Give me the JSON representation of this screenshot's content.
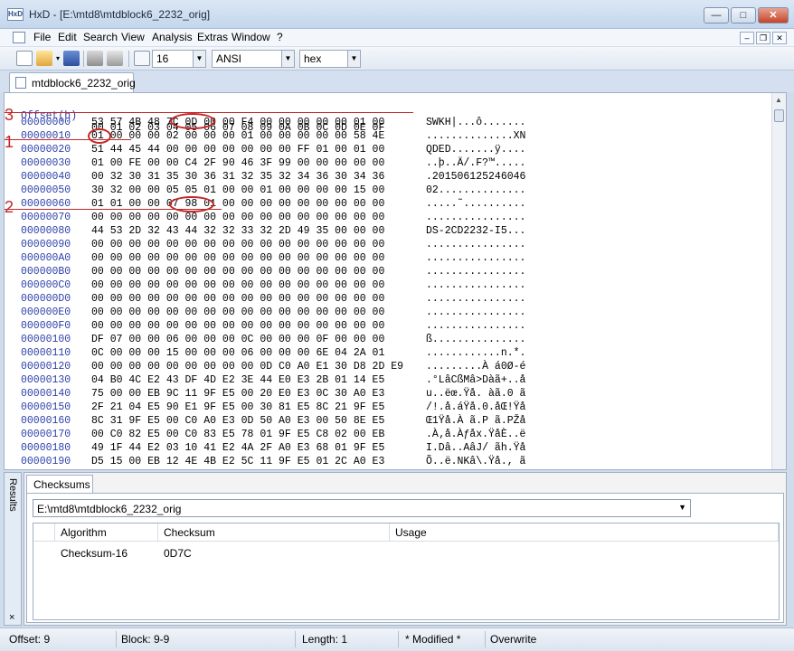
{
  "window": {
    "title": "HxD - [E:\\mtd8\\mtdblock6_2232_orig]",
    "app_icon_label": "HxD",
    "controls": {
      "minimize": "—",
      "maximize": "□",
      "close": "✕"
    }
  },
  "menu": {
    "items": [
      "File",
      "Edit",
      "Search",
      "View",
      "Analysis",
      "Extras",
      "Window",
      "?"
    ],
    "mdi_controls": [
      "–",
      "❐",
      "✕"
    ]
  },
  "toolbar": {
    "bytes_per_row": "16",
    "charset": "ANSI",
    "display": "hex",
    "icons": [
      "new-file-icon",
      "open-file-icon",
      "save-icon",
      "print-icon",
      "print-setup-icon",
      "columns-icon"
    ]
  },
  "document_tab": {
    "label": "mtdblock6_2232_orig"
  },
  "hex": {
    "header_label": "Offset(h)",
    "header_columns": "00 01 02 03 04 05 06 07 08 09 0A 0B 0C 0D 0E 0F",
    "rows": [
      {
        "offset": "00000000",
        "bytes": "53 57 4B 48 7C 0D 00 00 F4 00 00 00 00 00 01 00",
        "text": "SWKH|...ô......."
      },
      {
        "offset": "00000010",
        "bytes": "01 00 00 00 02 00 00 00 01 00 00 00 00 00 58 4E",
        "text": "..............XN"
      },
      {
        "offset": "00000020",
        "bytes": "51 44 45 44 00 00 00 00 00 00 00 FF 01 00 01 00",
        "text": "QDED.......ÿ...."
      },
      {
        "offset": "00000030",
        "bytes": "01 00 FE 00 00 C4 2F 90 46 3F 99 00 00 00 00 00",
        "text": "..þ..Ä/.F?™....."
      },
      {
        "offset": "00000040",
        "bytes": "00 32 30 31 35 30 36 31 32 35 32 34 36 30 34 36",
        "text": ".201506125246046"
      },
      {
        "offset": "00000050",
        "bytes": "30 32 00 00 05 05 01 00 00 01 00 00 00 00 15 00",
        "text": "02.............."
      },
      {
        "offset": "00000060",
        "bytes": "01 01 00 00 07 98 01 00 00 00 00 00 00 00 00 00",
        "text": ".....˜.........."
      },
      {
        "offset": "00000070",
        "bytes": "00 00 00 00 00 00 00 00 00 00 00 00 00 00 00 00",
        "text": "................"
      },
      {
        "offset": "00000080",
        "bytes": "44 53 2D 32 43 44 32 32 33 32 2D 49 35 00 00 00",
        "text": "DS-2CD2232-I5..."
      },
      {
        "offset": "00000090",
        "bytes": "00 00 00 00 00 00 00 00 00 00 00 00 00 00 00 00",
        "text": "................"
      },
      {
        "offset": "000000A0",
        "bytes": "00 00 00 00 00 00 00 00 00 00 00 00 00 00 00 00",
        "text": "................"
      },
      {
        "offset": "000000B0",
        "bytes": "00 00 00 00 00 00 00 00 00 00 00 00 00 00 00 00",
        "text": "................"
      },
      {
        "offset": "000000C0",
        "bytes": "00 00 00 00 00 00 00 00 00 00 00 00 00 00 00 00",
        "text": "................"
      },
      {
        "offset": "000000D0",
        "bytes": "00 00 00 00 00 00 00 00 00 00 00 00 00 00 00 00",
        "text": "................"
      },
      {
        "offset": "000000E0",
        "bytes": "00 00 00 00 00 00 00 00 00 00 00 00 00 00 00 00",
        "text": "................"
      },
      {
        "offset": "000000F0",
        "bytes": "00 00 00 00 00 00 00 00 00 00 00 00 00 00 00 00",
        "text": "................"
      },
      {
        "offset": "00000100",
        "bytes": "DF 07 00 00 06 00 00 00 0C 00 00 00 0F 00 00 00",
        "text": "ß..............."
      },
      {
        "offset": "00000110",
        "bytes": "0C 00 00 00 15 00 00 00 06 00 00 00 6E 04 2A 01",
        "text": "............n.*."
      },
      {
        "offset": "00000120",
        "bytes": "00 00 00 00 00 00 00 00 00 0D C0 A0 E1 30 D8 2D E9",
        "text": ".........À á0Ø-é"
      },
      {
        "offset": "00000130",
        "bytes": "04 B0 4C E2 43 DF 4D E2 3E 44 E0 E3 2B 01 14 E5",
        "text": ".°LâCßMâ>Dàã+..å"
      },
      {
        "offset": "00000140",
        "bytes": "75 00 00 EB 9C 11 9F E5 00 20 E0 E3 0C 30 A0 E3",
        "text": "u..ëœ.Ÿå. àã.0 ã"
      },
      {
        "offset": "00000150",
        "bytes": "2F 21 04 E5 90 E1 9F E5 00 30 81 E5 8C 21 9F E5",
        "text": "/!.å.áŸå.0.åŒ!Ÿå"
      },
      {
        "offset": "00000160",
        "bytes": "8C 31 9F E5 00 C0 A0 E3 0D 50 A0 E3 00 50 8E E5",
        "text": "Œ1Ÿå.À ã.P ã.PŽå"
      },
      {
        "offset": "00000170",
        "bytes": "00 C0 82 E5 00 C0 83 E5 78 01 9F E5 C8 02 00 EB",
        "text": ".À‚å.Àƒåx.ŸåÈ..ë"
      },
      {
        "offset": "00000180",
        "bytes": "49 1F 44 E2 03 10 41 E2 4A 2F A0 E3 68 01 9F E5",
        "text": "I.Dâ..AâJ/ ãh.Ÿå"
      },
      {
        "offset": "00000190",
        "bytes": "D5 15 00 EB 12 4E 4B E2 5C 11 9F E5 01 2C A0 E3",
        "text": "Õ..ë.NKâ\\.Ÿå., ã"
      }
    ]
  },
  "annotations": [
    {
      "label": "3"
    },
    {
      "label": "1"
    },
    {
      "label": "2"
    }
  ],
  "results": {
    "side_label": "Results",
    "close": "×",
    "tab": "Checksums",
    "file_select": "E:\\mtd8\\mtdblock6_2232_orig",
    "columns": [
      "Algorithm",
      "Checksum",
      "Usage"
    ],
    "rows": [
      {
        "algorithm": "Checksum-16",
        "checksum": "0D7C",
        "usage": ""
      }
    ]
  },
  "status": {
    "offset": "Offset: 9",
    "block": "Block: 9-9",
    "length": "Length: 1",
    "modified": "* Modified *",
    "mode": "Overwrite"
  }
}
